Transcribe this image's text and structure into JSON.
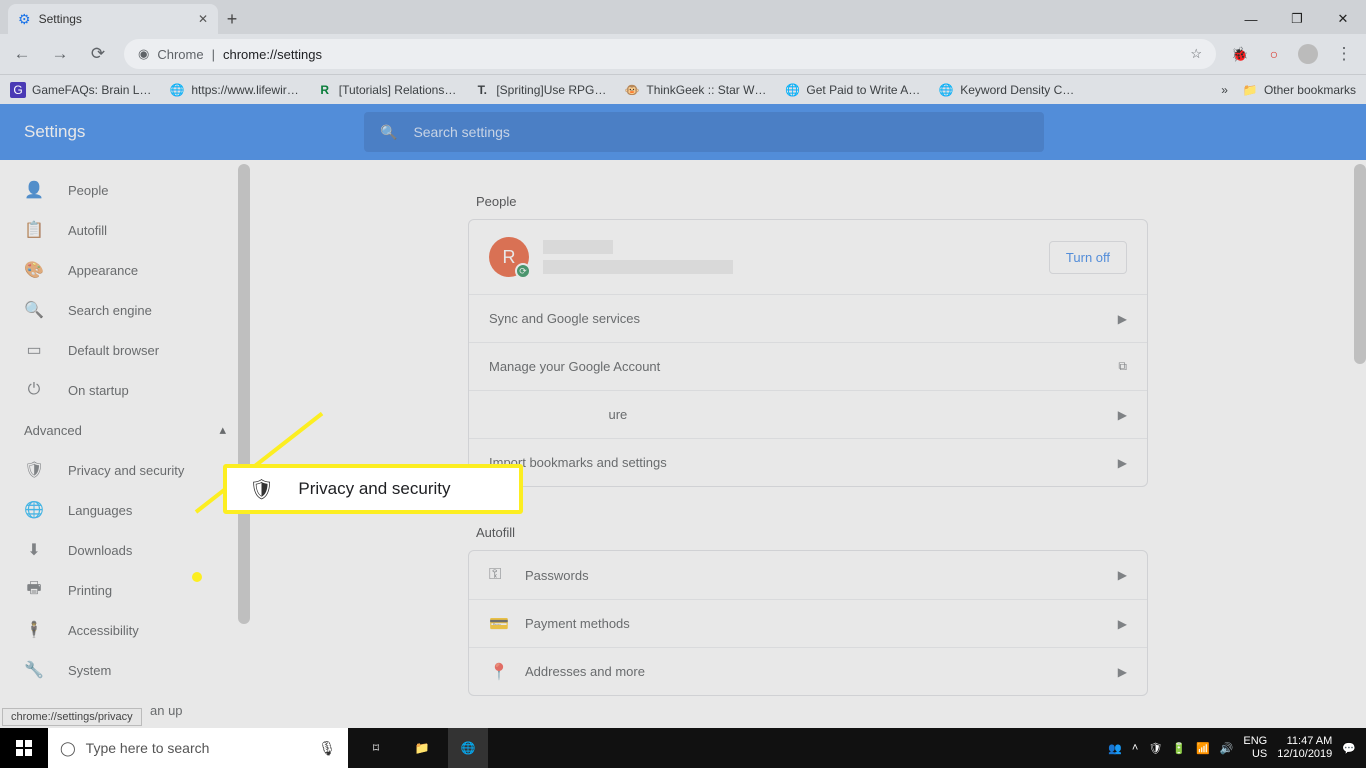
{
  "window": {
    "tab_title": "Settings"
  },
  "toolbar": {
    "origin_label": "Chrome",
    "url": "chrome://settings"
  },
  "bookmarks": {
    "items": [
      "GameFAQs: Brain L…",
      "https://www.lifewir…",
      "[Tutorials] Relations…",
      "[Spriting]Use RPG…",
      "ThinkGeek :: Star W…",
      "Get Paid to Write A…",
      "Keyword Density C…"
    ],
    "other": "Other bookmarks"
  },
  "app": {
    "title": "Settings",
    "search_placeholder": "Search settings"
  },
  "sidebar": {
    "items": [
      "People",
      "Autofill",
      "Appearance",
      "Search engine",
      "Default browser",
      "On startup"
    ],
    "advanced_label": "Advanced",
    "adv_items": [
      "Privacy and security",
      "Languages",
      "Downloads",
      "Printing",
      "Accessibility",
      "System"
    ],
    "cleanup_tail": "an up"
  },
  "people": {
    "header": "People",
    "avatar_initial": "R",
    "turn_off": "Turn off",
    "rows": [
      "Sync and Google services",
      "Manage your Google Account",
      "",
      "Import bookmarks and settings"
    ],
    "row2_tail": "ure"
  },
  "autofill": {
    "header": "Autofill",
    "rows": [
      "Passwords",
      "Payment methods",
      "Addresses and more"
    ]
  },
  "callout": {
    "label": "Privacy and security"
  },
  "status_url": "chrome://settings/privacy",
  "taskbar": {
    "search_placeholder": "Type here to search",
    "lang": "ENG",
    "region": "US",
    "time": "11:47 AM",
    "date": "12/10/2019"
  }
}
